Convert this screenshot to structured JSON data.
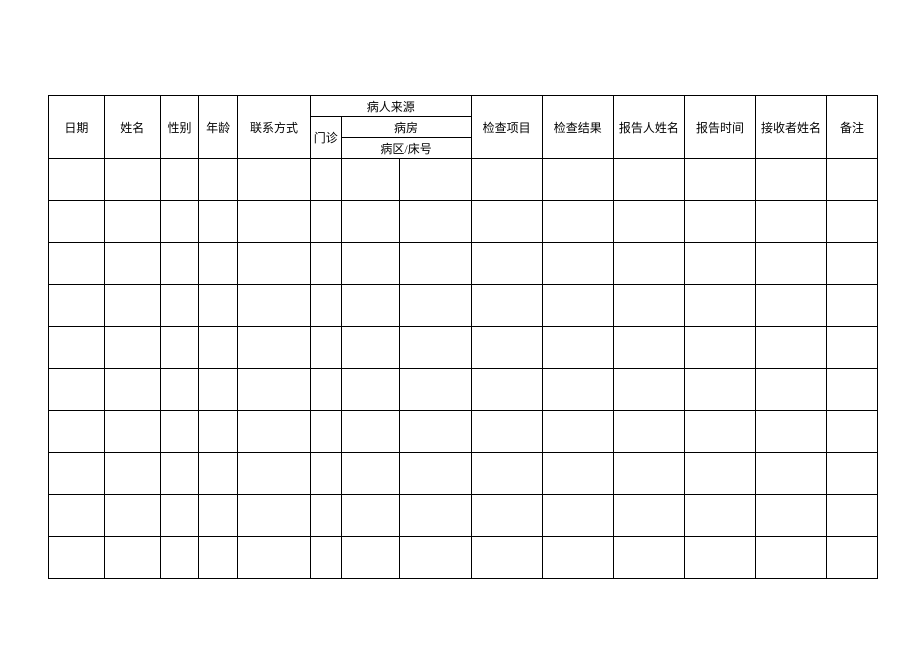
{
  "headers": {
    "date": "日期",
    "name": "姓名",
    "sex": "性别",
    "age": "年龄",
    "contact": "联系方式",
    "source_group": "病人来源",
    "source_outpatient": "门诊",
    "source_ward": "病房",
    "source_bed": "病区/床号",
    "exam_item": "检查项目",
    "exam_result": "检查结果",
    "reporter_name": "报告人姓名",
    "report_time": "报告时间",
    "receiver_name": "接收者姓名",
    "remark": "备注"
  },
  "data_row_count": 10
}
